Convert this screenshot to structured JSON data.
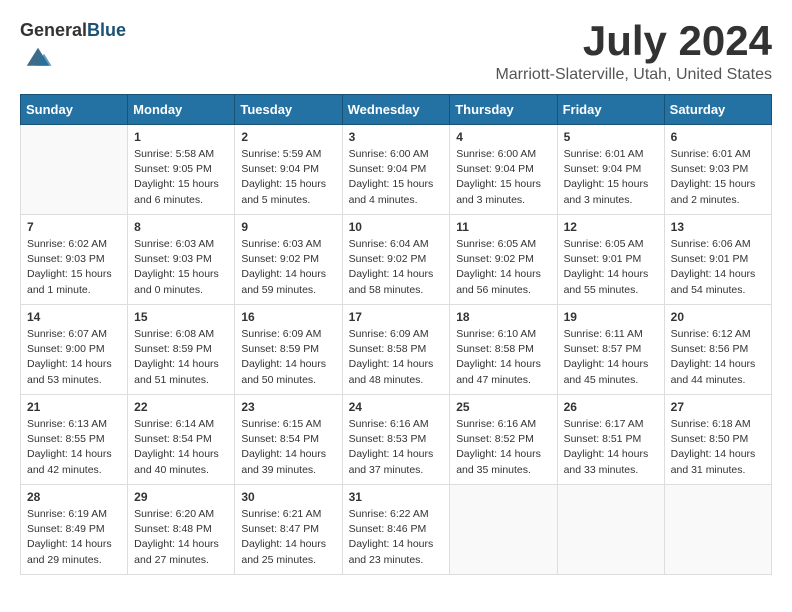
{
  "header": {
    "logo_general": "General",
    "logo_blue": "Blue",
    "month": "July 2024",
    "location": "Marriott-Slaterville, Utah, United States"
  },
  "days_of_week": [
    "Sunday",
    "Monday",
    "Tuesday",
    "Wednesday",
    "Thursday",
    "Friday",
    "Saturday"
  ],
  "weeks": [
    [
      {
        "day": "",
        "sunrise": "",
        "sunset": "",
        "daylight": "",
        "empty": true
      },
      {
        "day": "1",
        "sunrise": "Sunrise: 5:58 AM",
        "sunset": "Sunset: 9:05 PM",
        "daylight": "Daylight: 15 hours and 6 minutes."
      },
      {
        "day": "2",
        "sunrise": "Sunrise: 5:59 AM",
        "sunset": "Sunset: 9:04 PM",
        "daylight": "Daylight: 15 hours and 5 minutes."
      },
      {
        "day": "3",
        "sunrise": "Sunrise: 6:00 AM",
        "sunset": "Sunset: 9:04 PM",
        "daylight": "Daylight: 15 hours and 4 minutes."
      },
      {
        "day": "4",
        "sunrise": "Sunrise: 6:00 AM",
        "sunset": "Sunset: 9:04 PM",
        "daylight": "Daylight: 15 hours and 3 minutes."
      },
      {
        "day": "5",
        "sunrise": "Sunrise: 6:01 AM",
        "sunset": "Sunset: 9:04 PM",
        "daylight": "Daylight: 15 hours and 3 minutes."
      },
      {
        "day": "6",
        "sunrise": "Sunrise: 6:01 AM",
        "sunset": "Sunset: 9:03 PM",
        "daylight": "Daylight: 15 hours and 2 minutes."
      }
    ],
    [
      {
        "day": "7",
        "sunrise": "Sunrise: 6:02 AM",
        "sunset": "Sunset: 9:03 PM",
        "daylight": "Daylight: 15 hours and 1 minute."
      },
      {
        "day": "8",
        "sunrise": "Sunrise: 6:03 AM",
        "sunset": "Sunset: 9:03 PM",
        "daylight": "Daylight: 15 hours and 0 minutes."
      },
      {
        "day": "9",
        "sunrise": "Sunrise: 6:03 AM",
        "sunset": "Sunset: 9:02 PM",
        "daylight": "Daylight: 14 hours and 59 minutes."
      },
      {
        "day": "10",
        "sunrise": "Sunrise: 6:04 AM",
        "sunset": "Sunset: 9:02 PM",
        "daylight": "Daylight: 14 hours and 58 minutes."
      },
      {
        "day": "11",
        "sunrise": "Sunrise: 6:05 AM",
        "sunset": "Sunset: 9:02 PM",
        "daylight": "Daylight: 14 hours and 56 minutes."
      },
      {
        "day": "12",
        "sunrise": "Sunrise: 6:05 AM",
        "sunset": "Sunset: 9:01 PM",
        "daylight": "Daylight: 14 hours and 55 minutes."
      },
      {
        "day": "13",
        "sunrise": "Sunrise: 6:06 AM",
        "sunset": "Sunset: 9:01 PM",
        "daylight": "Daylight: 14 hours and 54 minutes."
      }
    ],
    [
      {
        "day": "14",
        "sunrise": "Sunrise: 6:07 AM",
        "sunset": "Sunset: 9:00 PM",
        "daylight": "Daylight: 14 hours and 53 minutes."
      },
      {
        "day": "15",
        "sunrise": "Sunrise: 6:08 AM",
        "sunset": "Sunset: 8:59 PM",
        "daylight": "Daylight: 14 hours and 51 minutes."
      },
      {
        "day": "16",
        "sunrise": "Sunrise: 6:09 AM",
        "sunset": "Sunset: 8:59 PM",
        "daylight": "Daylight: 14 hours and 50 minutes."
      },
      {
        "day": "17",
        "sunrise": "Sunrise: 6:09 AM",
        "sunset": "Sunset: 8:58 PM",
        "daylight": "Daylight: 14 hours and 48 minutes."
      },
      {
        "day": "18",
        "sunrise": "Sunrise: 6:10 AM",
        "sunset": "Sunset: 8:58 PM",
        "daylight": "Daylight: 14 hours and 47 minutes."
      },
      {
        "day": "19",
        "sunrise": "Sunrise: 6:11 AM",
        "sunset": "Sunset: 8:57 PM",
        "daylight": "Daylight: 14 hours and 45 minutes."
      },
      {
        "day": "20",
        "sunrise": "Sunrise: 6:12 AM",
        "sunset": "Sunset: 8:56 PM",
        "daylight": "Daylight: 14 hours and 44 minutes."
      }
    ],
    [
      {
        "day": "21",
        "sunrise": "Sunrise: 6:13 AM",
        "sunset": "Sunset: 8:55 PM",
        "daylight": "Daylight: 14 hours and 42 minutes."
      },
      {
        "day": "22",
        "sunrise": "Sunrise: 6:14 AM",
        "sunset": "Sunset: 8:54 PM",
        "daylight": "Daylight: 14 hours and 40 minutes."
      },
      {
        "day": "23",
        "sunrise": "Sunrise: 6:15 AM",
        "sunset": "Sunset: 8:54 PM",
        "daylight": "Daylight: 14 hours and 39 minutes."
      },
      {
        "day": "24",
        "sunrise": "Sunrise: 6:16 AM",
        "sunset": "Sunset: 8:53 PM",
        "daylight": "Daylight: 14 hours and 37 minutes."
      },
      {
        "day": "25",
        "sunrise": "Sunrise: 6:16 AM",
        "sunset": "Sunset: 8:52 PM",
        "daylight": "Daylight: 14 hours and 35 minutes."
      },
      {
        "day": "26",
        "sunrise": "Sunrise: 6:17 AM",
        "sunset": "Sunset: 8:51 PM",
        "daylight": "Daylight: 14 hours and 33 minutes."
      },
      {
        "day": "27",
        "sunrise": "Sunrise: 6:18 AM",
        "sunset": "Sunset: 8:50 PM",
        "daylight": "Daylight: 14 hours and 31 minutes."
      }
    ],
    [
      {
        "day": "28",
        "sunrise": "Sunrise: 6:19 AM",
        "sunset": "Sunset: 8:49 PM",
        "daylight": "Daylight: 14 hours and 29 minutes."
      },
      {
        "day": "29",
        "sunrise": "Sunrise: 6:20 AM",
        "sunset": "Sunset: 8:48 PM",
        "daylight": "Daylight: 14 hours and 27 minutes."
      },
      {
        "day": "30",
        "sunrise": "Sunrise: 6:21 AM",
        "sunset": "Sunset: 8:47 PM",
        "daylight": "Daylight: 14 hours and 25 minutes."
      },
      {
        "day": "31",
        "sunrise": "Sunrise: 6:22 AM",
        "sunset": "Sunset: 8:46 PM",
        "daylight": "Daylight: 14 hours and 23 minutes."
      },
      {
        "day": "",
        "sunrise": "",
        "sunset": "",
        "daylight": "",
        "empty": true
      },
      {
        "day": "",
        "sunrise": "",
        "sunset": "",
        "daylight": "",
        "empty": true
      },
      {
        "day": "",
        "sunrise": "",
        "sunset": "",
        "daylight": "",
        "empty": true
      }
    ]
  ]
}
